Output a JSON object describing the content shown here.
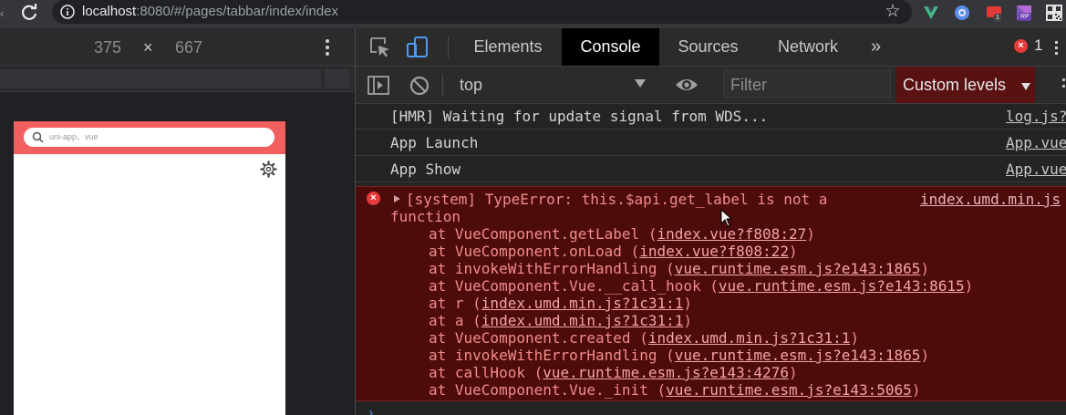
{
  "browser": {
    "url_host": "localhost",
    "url_rest": ":8080/#/pages/tabbar/index/index",
    "extensions": [
      {
        "name": "vue-devtools-icon",
        "color": "#41b883"
      },
      {
        "name": "extension-blue-icon",
        "color": "#5a8dee"
      },
      {
        "name": "extension-red-icon",
        "color": "#e53935",
        "badge": "1"
      },
      {
        "name": "extension-rp-icon",
        "color": "#7e57c2",
        "badge": "RP"
      },
      {
        "name": "qr-code-icon",
        "color": "#e0e0e0"
      }
    ]
  },
  "device": {
    "width": "375",
    "times": "×",
    "height": "667"
  },
  "app": {
    "header_color": "#f15f5f",
    "search_placeholder": "uni-app、vue"
  },
  "devtools": {
    "tabs": [
      {
        "label": "Elements",
        "active": false
      },
      {
        "label": "Console",
        "active": true
      },
      {
        "label": "Sources",
        "active": false
      },
      {
        "label": "Network",
        "active": false
      }
    ],
    "more_tabs": "»",
    "error_count": "1",
    "context": "top",
    "filter_placeholder": "Filter",
    "levels_label": "Custom levels"
  },
  "console": {
    "logs": [
      {
        "message": "[HMR] Waiting for update signal from WDS...",
        "source": "log.js?"
      },
      {
        "message": "App Launch",
        "source": "App.vue"
      },
      {
        "message": "App Show",
        "source": "App.vue"
      }
    ],
    "error": {
      "head": "[system] TypeError: this.$api.get_label is not a",
      "cont": "function",
      "source": "index.umd.min.js",
      "frames": [
        {
          "text": "at VueComponent.getLabel (",
          "loc": "index.vue?f808:27",
          "end": ")"
        },
        {
          "text": "at VueComponent.onLoad (",
          "loc": "index.vue?f808:22",
          "end": ")"
        },
        {
          "text": "at invokeWithErrorHandling (",
          "loc": "vue.runtime.esm.js?e143:1865",
          "end": ")"
        },
        {
          "text": "at VueComponent.Vue.__call_hook (",
          "loc": "vue.runtime.esm.js?e143:8615",
          "end": ")"
        },
        {
          "text": "at r (",
          "loc": "index.umd.min.js?1c31:1",
          "end": ")"
        },
        {
          "text": "at a (",
          "loc": "index.umd.min.js?1c31:1",
          "end": ")"
        },
        {
          "text": "at VueComponent.created (",
          "loc": "index.umd.min.js?1c31:1",
          "end": ")"
        },
        {
          "text": "at invokeWithErrorHandling (",
          "loc": "vue.runtime.esm.js?e143:1865",
          "end": ")"
        },
        {
          "text": "at callHook (",
          "loc": "vue.runtime.esm.js?e143:4276",
          "end": ")"
        },
        {
          "text": "at VueComponent.Vue._init (",
          "loc": "vue.runtime.esm.js?e143:5065",
          "end": ")"
        }
      ]
    },
    "prompt": "›"
  }
}
